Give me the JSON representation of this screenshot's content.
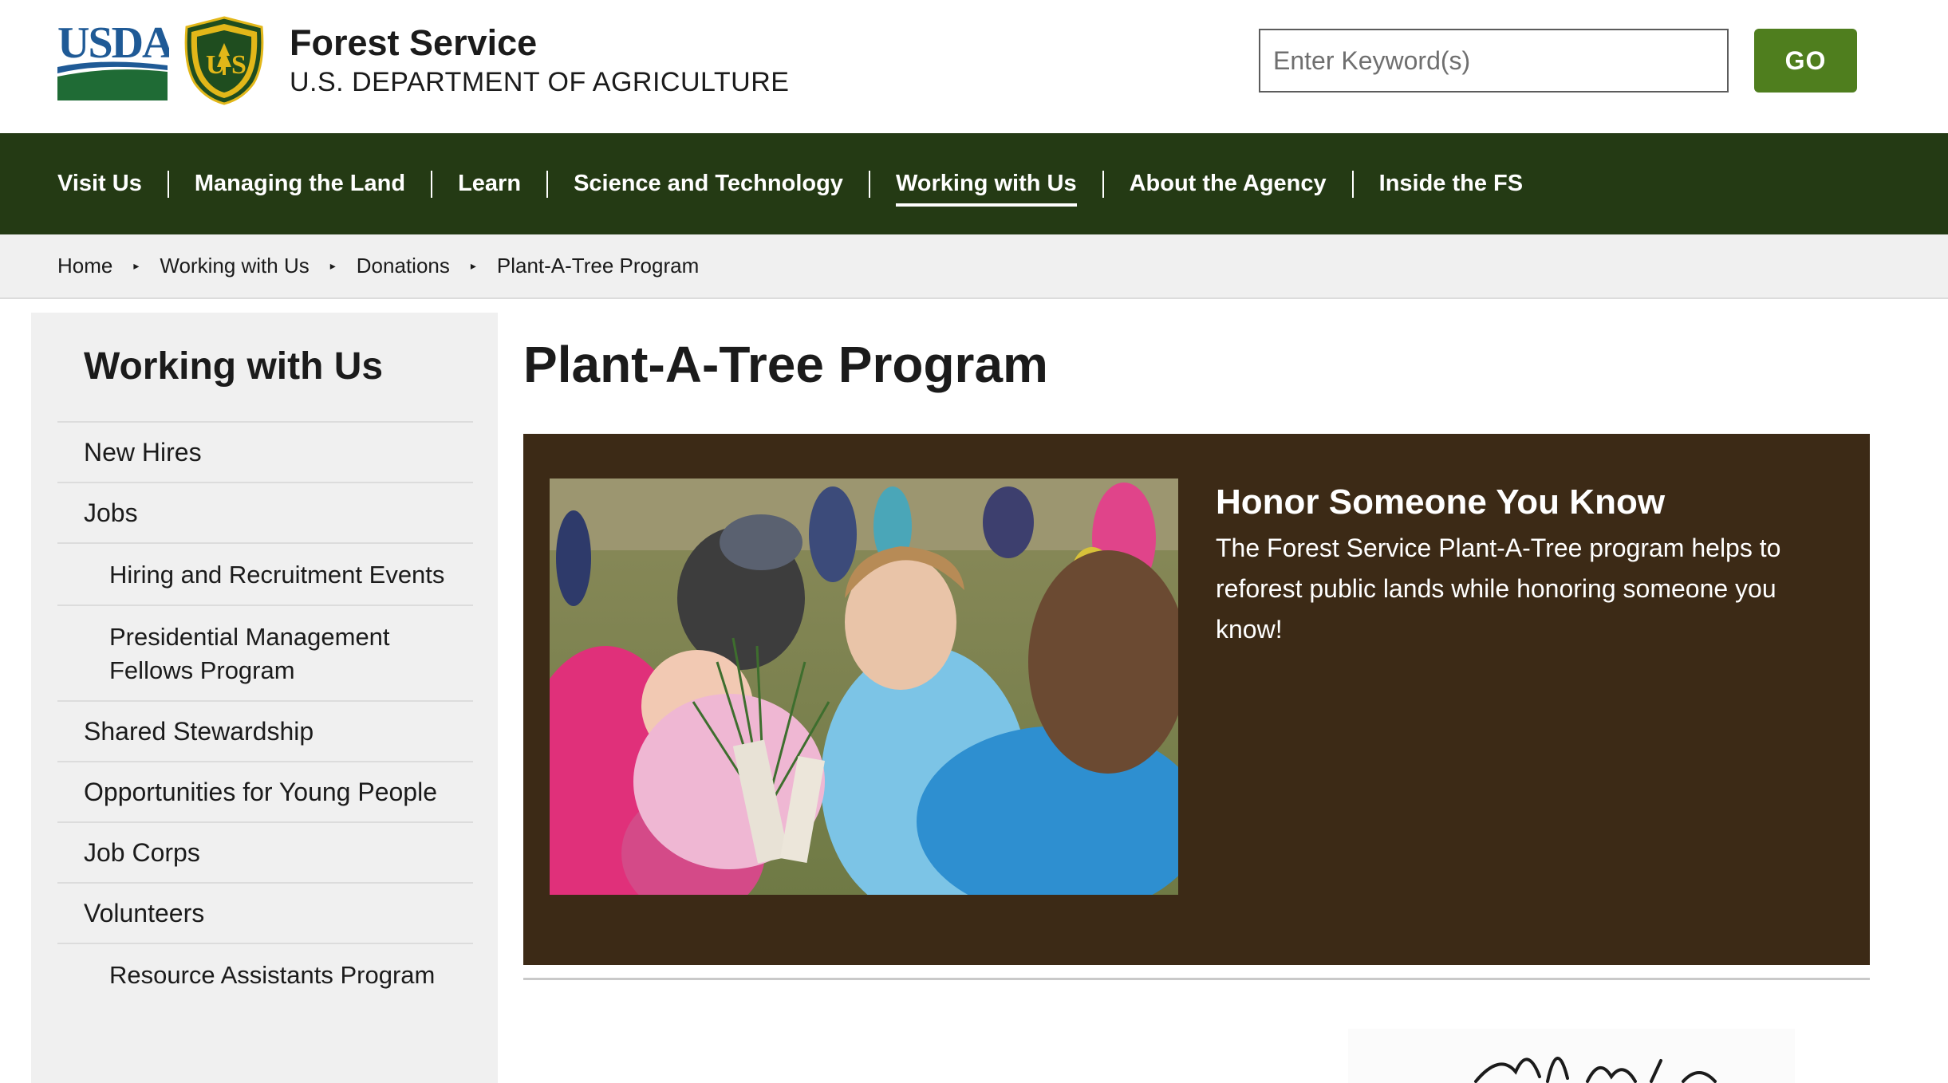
{
  "header": {
    "usda_logo_text": "USDA",
    "shield_text": "FOREST SERVICE · US · DEPARTMENT OF AGRICULTURE",
    "agency_name": "Forest Service",
    "department": "U.S. DEPARTMENT OF AGRICULTURE",
    "search_placeholder": "Enter Keyword(s)",
    "search_button": "GO"
  },
  "nav": {
    "items": [
      {
        "label": "Visit Us"
      },
      {
        "label": "Managing the Land"
      },
      {
        "label": "Learn"
      },
      {
        "label": "Science and Technology"
      },
      {
        "label": "Working with Us",
        "active": true
      },
      {
        "label": "About the Agency"
      },
      {
        "label": "Inside the FS"
      }
    ]
  },
  "breadcrumb": [
    "Home",
    "Working with Us",
    "Donations",
    "Plant-A-Tree Program"
  ],
  "sidebar": {
    "title": "Working with Us",
    "items": [
      {
        "label": "New Hires"
      },
      {
        "label": "Jobs"
      },
      {
        "label": "Hiring and Recruitment Events",
        "sub": true
      },
      {
        "label": "Presidential Management Fellows Program",
        "sub": true
      },
      {
        "label": "Shared Stewardship"
      },
      {
        "label": "Opportunities for Young People"
      },
      {
        "label": "Job Corps"
      },
      {
        "label": "Volunteers"
      },
      {
        "label": "Resource Assistants Program",
        "sub": true
      }
    ]
  },
  "main": {
    "title": "Plant-A-Tree Program",
    "feature": {
      "heading": "Honor Someone You Know",
      "body": "The Forest Service Plant-A-Tree program helps to reforest public lands while honoring someone you know!"
    }
  },
  "colors": {
    "nav_bg": "#243a14",
    "go_button": "#4f7e1e",
    "feature_bg": "#3c2a16",
    "breadcrumb_bg": "#f0f0f0",
    "sidebar_bg": "#f0f0f0",
    "usda_blue": "#1f5a96",
    "usda_green": "#1f6b35"
  }
}
